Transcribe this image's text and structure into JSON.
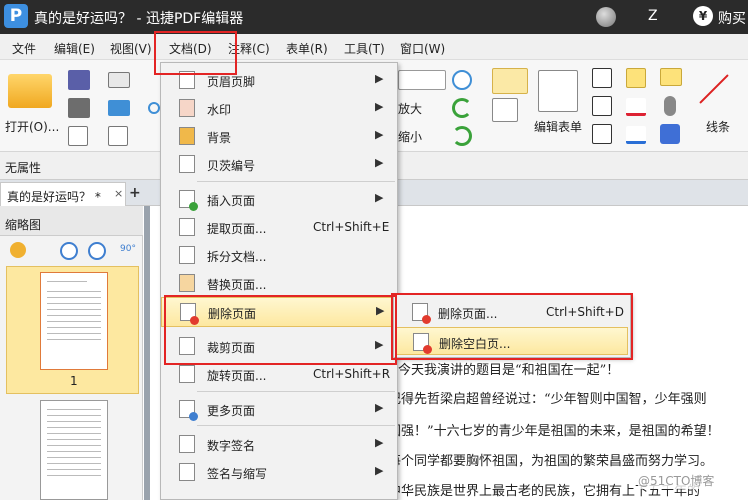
{
  "titlebar": {
    "logo": "P",
    "title": "真的是好运吗？ - 迅捷PDF编辑器",
    "user_initial": "Z",
    "currency_symbol": "¥",
    "buy_label": "购买"
  },
  "menubar": [
    "文件",
    "编辑(E)",
    "视图(V)",
    "文档(D)",
    "注释(C)",
    "表单(R)",
    "工具(T)",
    "窗口(W)"
  ],
  "toolbar": {
    "open_label": "打开(O)...",
    "zoom_in_label": "放大",
    "zoom_out_label": "缩小",
    "edit_form_label": "编辑表单",
    "line_label": "线条"
  },
  "propbar": {
    "label": "无属性"
  },
  "tabs": {
    "doc_tab": "真的是好运吗？ *",
    "close": "×",
    "add": "+"
  },
  "sidepanel": {
    "header": "缩略图",
    "page_number": "1",
    "rotate_label": "90°"
  },
  "document_lines": [
    "今天我演讲的题目是“和祖国在一起”！",
    "记得先哲梁启超曾经说过：“少年智则中国智，少年强则",
    "国强！”十六七岁的青少年是祖国的未来，是祖国的希望！",
    "每个同学都要胸怀祖国，为祖国的繁荣昌盛而努力学习。",
    "中华民族是世界上最古老的民族，它拥有上下五千年的"
  ],
  "watermark": "@51CTO博客",
  "dropdown": {
    "items": [
      {
        "label": "页眉页脚",
        "shortcut": "",
        "arrow": "▶"
      },
      {
        "label": "水印",
        "shortcut": "",
        "arrow": "▶"
      },
      {
        "label": "背景",
        "shortcut": "",
        "arrow": "▶"
      },
      {
        "label": "贝茨编号",
        "shortcut": "",
        "arrow": "▶"
      },
      {
        "label": "插入页面",
        "shortcut": "",
        "arrow": "▶"
      },
      {
        "label": "提取页面...",
        "shortcut": "Ctrl+Shift+E",
        "arrow": ""
      },
      {
        "label": "拆分文档...",
        "shortcut": "",
        "arrow": ""
      },
      {
        "label": "替换页面...",
        "shortcut": "",
        "arrow": ""
      },
      {
        "label": "删除页面",
        "shortcut": "",
        "arrow": "▶"
      },
      {
        "label": "裁剪页面",
        "shortcut": "",
        "arrow": "▶"
      },
      {
        "label": "旋转页面...",
        "shortcut": "Ctrl+Shift+R",
        "arrow": ""
      },
      {
        "label": "更多页面",
        "shortcut": "",
        "arrow": "▶"
      },
      {
        "label": "数字签名",
        "shortcut": "",
        "arrow": "▶"
      },
      {
        "label": "签名与缩写",
        "shortcut": "",
        "arrow": "▶"
      }
    ]
  },
  "submenu": {
    "items": [
      {
        "label": "删除页面...",
        "shortcut": "Ctrl+Shift+D"
      },
      {
        "label": "删除空白页...",
        "shortcut": ""
      }
    ]
  },
  "colors": {
    "titlebar_bg": "#2b2b2b",
    "highlight_border": "#e32424",
    "menu_highlight": "#fde8a0"
  }
}
